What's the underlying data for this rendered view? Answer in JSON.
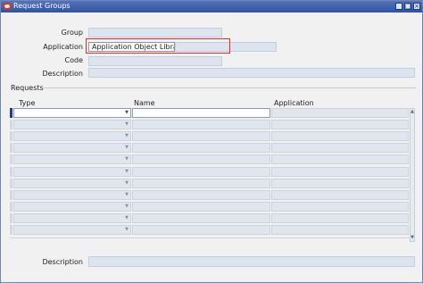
{
  "window": {
    "title": "Request Groups"
  },
  "form": {
    "group_label": "Group",
    "application_label": "Application",
    "application_value": "Application Object Library",
    "code_label": "Code",
    "description_label": "Description"
  },
  "requests": {
    "section_title": "Requests",
    "columns": {
      "type": "Type",
      "name": "Name",
      "application": "Application"
    },
    "row_count": 11
  },
  "footer": {
    "description_label": "Description"
  },
  "colors": {
    "titlebar": "#3a5aa7",
    "highlight_border": "#ea2a2a",
    "field_bg": "#dce4ef"
  }
}
